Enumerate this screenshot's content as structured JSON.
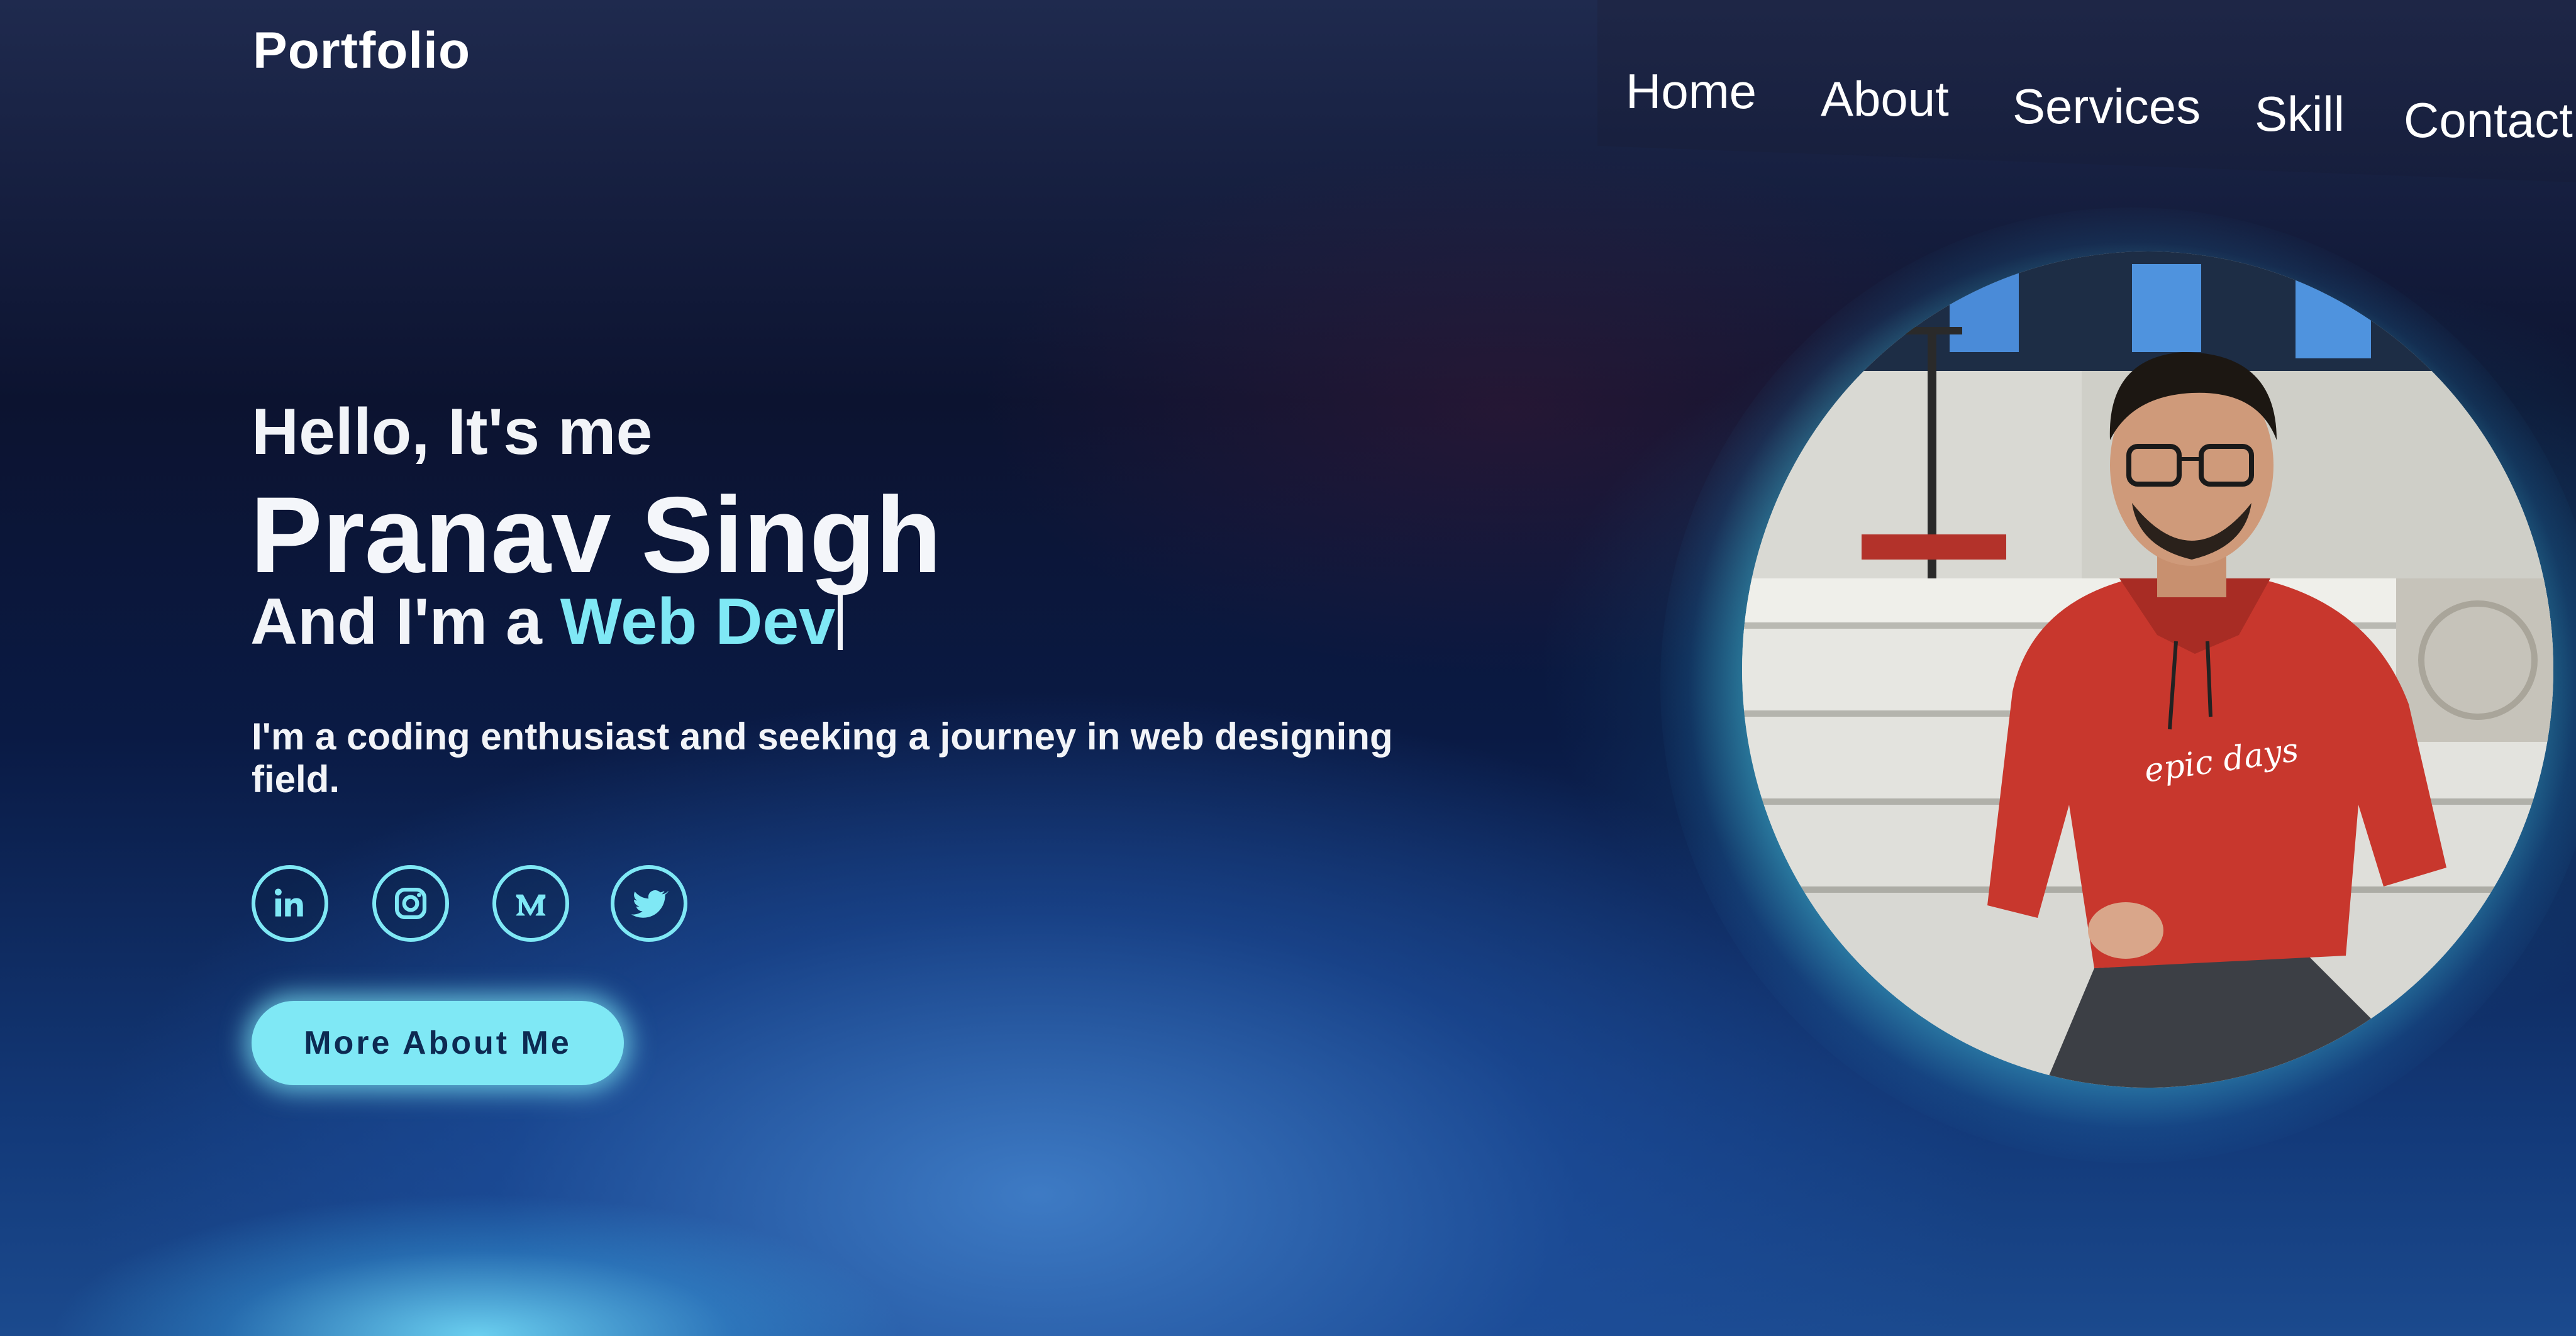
{
  "header": {
    "brand": "Portfolio",
    "nav": [
      "Home",
      "About",
      "Services",
      "Skill",
      "Contact"
    ]
  },
  "hero": {
    "greeting": "Hello, It's me",
    "name": "Pranav Singh",
    "role_prefix": "And I'm a ",
    "role_highlight": "Web Dev",
    "description": "I'm a coding enthusiast and seeking a journey in web designing field.",
    "button_label": "More About Me"
  },
  "social": [
    {
      "icon": "linkedin-icon"
    },
    {
      "icon": "instagram-icon"
    },
    {
      "icon": "medium-icon"
    },
    {
      "icon": "twitter-icon"
    }
  ],
  "portrait": {
    "shirt_text": "epic days"
  },
  "colors": {
    "accent": "#7fe8f5",
    "text": "#f2f4f8",
    "button_text": "#0d2a52"
  }
}
